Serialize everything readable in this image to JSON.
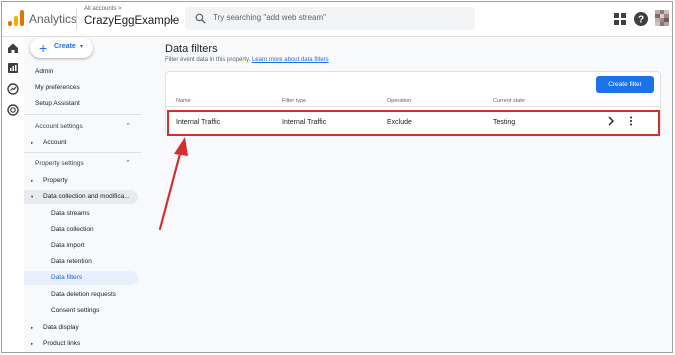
{
  "topbar": {
    "app_name": "Analytics",
    "account_crumb": "All accounts",
    "crumb_sep": ">",
    "property_name": "CrazyEggExample",
    "property_caret": "▾",
    "search_placeholder": "Try searching \"add web stream\"",
    "icons": [
      "apps-grid-icon",
      "help-icon",
      "avatar"
    ]
  },
  "rail": {
    "icons": [
      "home-icon",
      "reports-icon",
      "explore-icon",
      "advertising-icon"
    ]
  },
  "sidenav": {
    "create_label": "Create",
    "create_plus": "+",
    "create_caret": "▾",
    "chevron_up": "⌃",
    "triangle_right": "▸",
    "triangle_down": "▾",
    "items": {
      "admin": "Admin",
      "my_preferences": "My preferences",
      "setup_assistant": "Setup Assistant",
      "account_settings": "Account settings",
      "account": "Account",
      "property_settings": "Property settings",
      "property": "Property",
      "data_collection": "Data collection and modifica...",
      "data_streams": "Data streams",
      "data_collection_sub": "Data collection",
      "data_import": "Data import",
      "data_retention": "Data retention",
      "data_filters": "Data filters",
      "data_deletion": "Data deletion requests",
      "consent_settings": "Consent settings",
      "data_display": "Data display",
      "product_links": "Product links"
    }
  },
  "main": {
    "title": "Data filters",
    "description": "Filter event data in this property.",
    "learn_more": "Learn more about data filters",
    "create_filter_label": "Create filter",
    "columns": [
      "Name",
      "Filter type",
      "Operation",
      "Current state"
    ],
    "rows": [
      {
        "name": "Internal Traffic",
        "filter_type": "Internal Traffic",
        "operation": "Exclude",
        "state": "Testing"
      }
    ]
  },
  "colors": {
    "accent": "#1a73e8",
    "highlight": "#d32f2f",
    "logo_orange": "#e37400",
    "logo_yellow": "#f9ab00"
  }
}
